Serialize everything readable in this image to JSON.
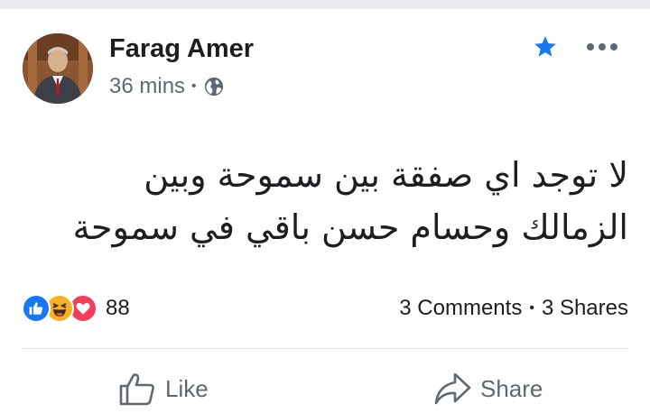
{
  "post": {
    "author": "Farag Amer",
    "timestamp": "36 mins",
    "separator": "•",
    "privacy_icon": "globe-icon",
    "menu_icons": [
      "star-icon",
      "more-icon"
    ],
    "text": "لا توجد اي صفقة بين سموحة وبين\nالزمالك  وحسام حسن باقي في سموحة"
  },
  "reactions": {
    "icons": [
      "like-reaction-icon",
      "haha-reaction-icon",
      "love-reaction-icon"
    ],
    "count": "88"
  },
  "stats": {
    "comments": "3 Comments",
    "separator": "•",
    "shares": "3 Shares"
  },
  "actions": {
    "like_label": "Like",
    "share_label": "Share"
  },
  "colors": {
    "star": "#1877f2",
    "like": "#1877f2",
    "haha": "#f7b125",
    "love": "#f33e58",
    "secondary_text": "#606770"
  }
}
